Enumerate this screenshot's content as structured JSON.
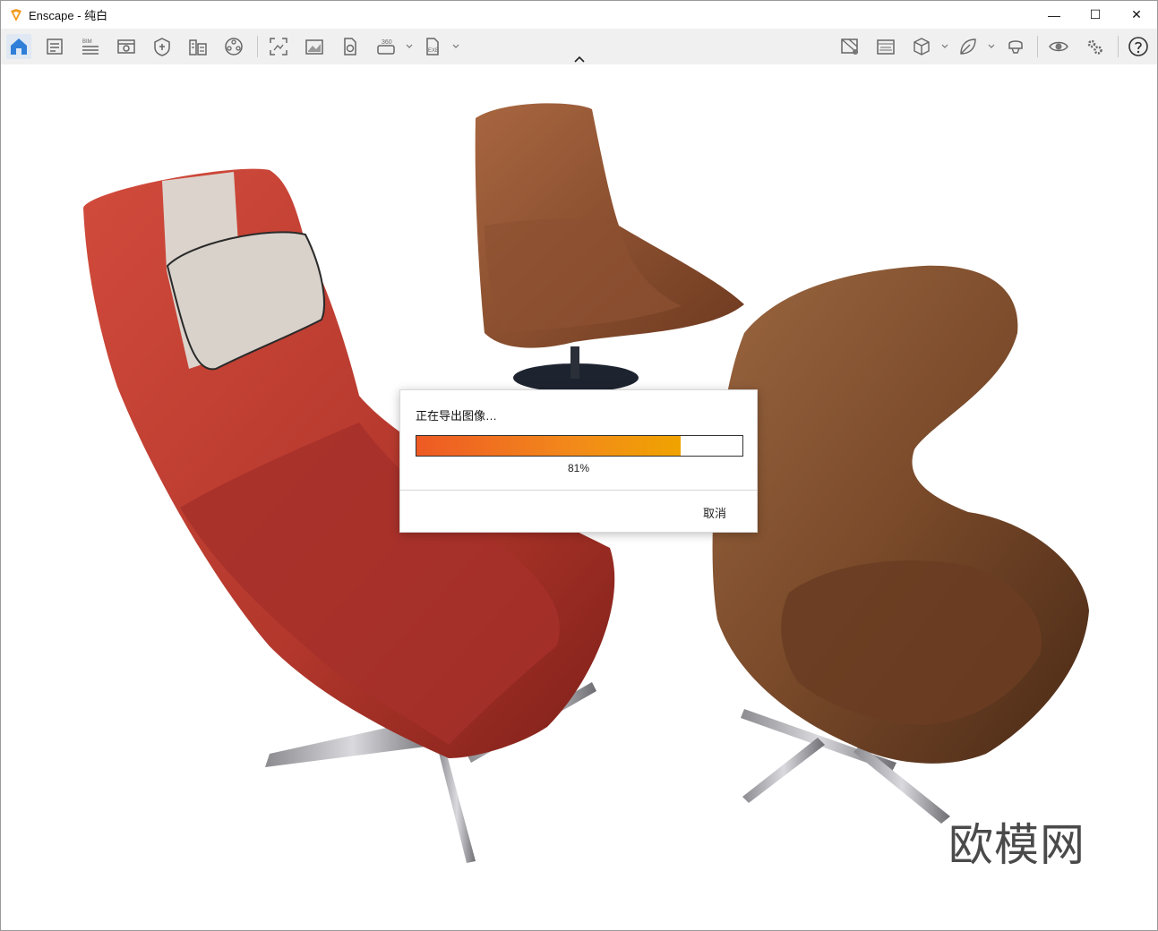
{
  "window": {
    "title": "Enscape - 纯白",
    "minimize": "—",
    "maximize": "☐",
    "close": "✕"
  },
  "toolbar": {
    "left_icons": [
      "home-icon",
      "notes-icon",
      "bim-icon",
      "views-icon",
      "visual-settings-icon",
      "site-context-icon",
      "object-library-icon",
      "video-editor-icon",
      "screenshot-icon",
      "batch-render-icon",
      "export-image-icon",
      "panorama-360-icon",
      "exe-export-icon"
    ],
    "right_icons": [
      "material-editor-icon",
      "atmosphere-icon",
      "cube-view-icon",
      "asset-library-icon",
      "vr-headset-icon",
      "visibility-icon",
      "settings-icon",
      "help-icon"
    ]
  },
  "watermark": {
    "brand": "欧模网"
  },
  "dialog": {
    "title": "正在导出图像…",
    "progress_fraction": 0.81,
    "percent_label": "81%",
    "cancel_label": "取消"
  },
  "colors": {
    "accent": "#f28a1a",
    "home_active": "#2f7fd8"
  }
}
